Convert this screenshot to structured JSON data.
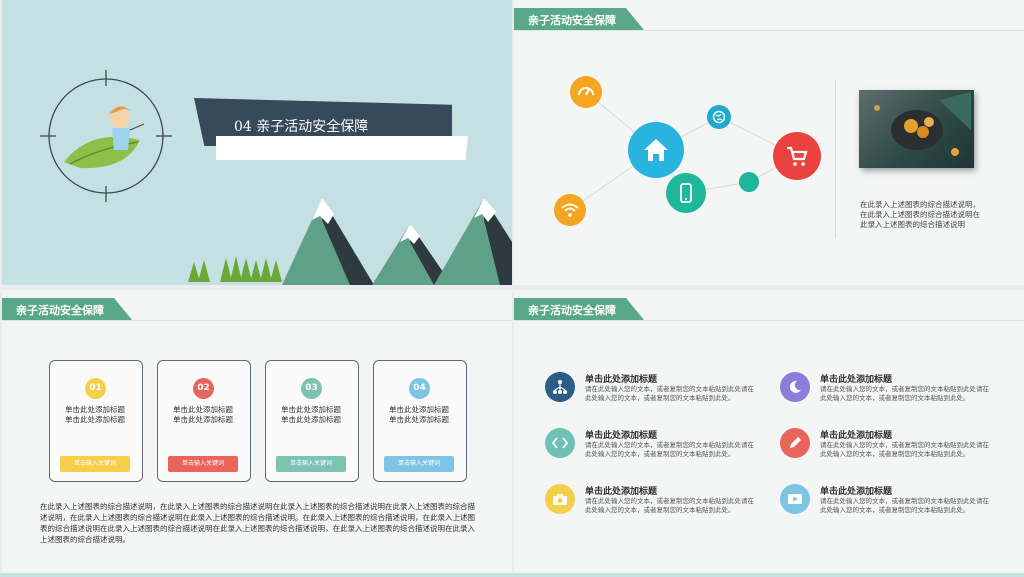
{
  "slide1": {
    "banner_text": "04  亲子活动安全保障"
  },
  "slide2": {
    "header": "亲子活动安全保障",
    "description": "在此录入上述图表的综合描述说明，在此录入上述图表的综合描述说明在此录入上述图表的综合描述说明",
    "icons": [
      "speedometer-icon",
      "globe-icon",
      "home-icon",
      "cart-icon",
      "phone-icon",
      "wifi-icon"
    ]
  },
  "slide3": {
    "header": "亲子活动安全保障",
    "cards": [
      {
        "num": "01",
        "text": "单击此处添加标题单击此处添加标题",
        "button": "单击输入关键词",
        "color": "#f4cf4a"
      },
      {
        "num": "02",
        "text": "单击此处添加标题单击此处添加标题",
        "button": "单击输入关键词",
        "color": "#e9645a"
      },
      {
        "num": "03",
        "text": "单击此处添加标题单击此处添加标题",
        "button": "单击输入关键词",
        "color": "#7cc3b2"
      },
      {
        "num": "04",
        "text": "单击此处添加标题单击此处添加标题",
        "button": "单击输入关键词",
        "color": "#7ec4e4"
      }
    ],
    "description": "在此录入上述图表的综合描述说明，在此录入上述图表的综合描述说明在此录入上述图表的综合描述说明在此录入上述图表的综合描述说明，在此录入上述图表的综合描述说明在此录入上述图表的综合描述说明。在此录入上述图表的综合描述说明，在此录入上述图表的综合描述说明在此录入上述图表的综合描述说明在此录入上述图表的综合描述说明，在此录入上述图表的综合描述说明在此录入上述图表的综合描述说明。"
  },
  "slide4": {
    "header": "亲子活动安全保障",
    "features": [
      {
        "title": "单击此处添加标题",
        "desc": "请在此处输入您的文本，或者复制您的文本粘贴到此处请在此处输入您的文本，或者复制您的文本粘贴到此处。",
        "icon": "network-icon",
        "color": "#2c5d86"
      },
      {
        "title": "单击此处添加标题",
        "desc": "请在此处输入您的文本，或者复制您的文本粘贴到此处请在此处输入您的文本，或者复制您的文本粘贴到此处。",
        "icon": "night-icon",
        "color": "#8c7ed8"
      },
      {
        "title": "单击此处添加标题",
        "desc": "请在此处输入您的文本，或者复制您的文本粘贴到此处请在此处输入您的文本，或者复制您的文本粘贴到此处。",
        "icon": "code-icon",
        "color": "#6dc1b6"
      },
      {
        "title": "单击此处添加标题",
        "desc": "请在此处输入您的文本，或者复制您的文本粘贴到此处请在此处输入您的文本，或者复制您的文本粘贴到此处。",
        "icon": "pencil-icon",
        "color": "#e9645a"
      },
      {
        "title": "单击此处添加标题",
        "desc": "请在此处输入您的文本，或者复制您的文本粘贴到此处请在此处输入您的文本，或者复制您的文本粘贴到此处。",
        "icon": "camera-icon",
        "color": "#f4cf4a"
      },
      {
        "title": "单击此处添加标题",
        "desc": "请在此处输入您的文本，或者复制您的文本粘贴到此处请在此处输入您的文本，或者复制您的文本粘贴到此处。",
        "icon": "video-icon",
        "color": "#7ec4e4"
      }
    ]
  }
}
